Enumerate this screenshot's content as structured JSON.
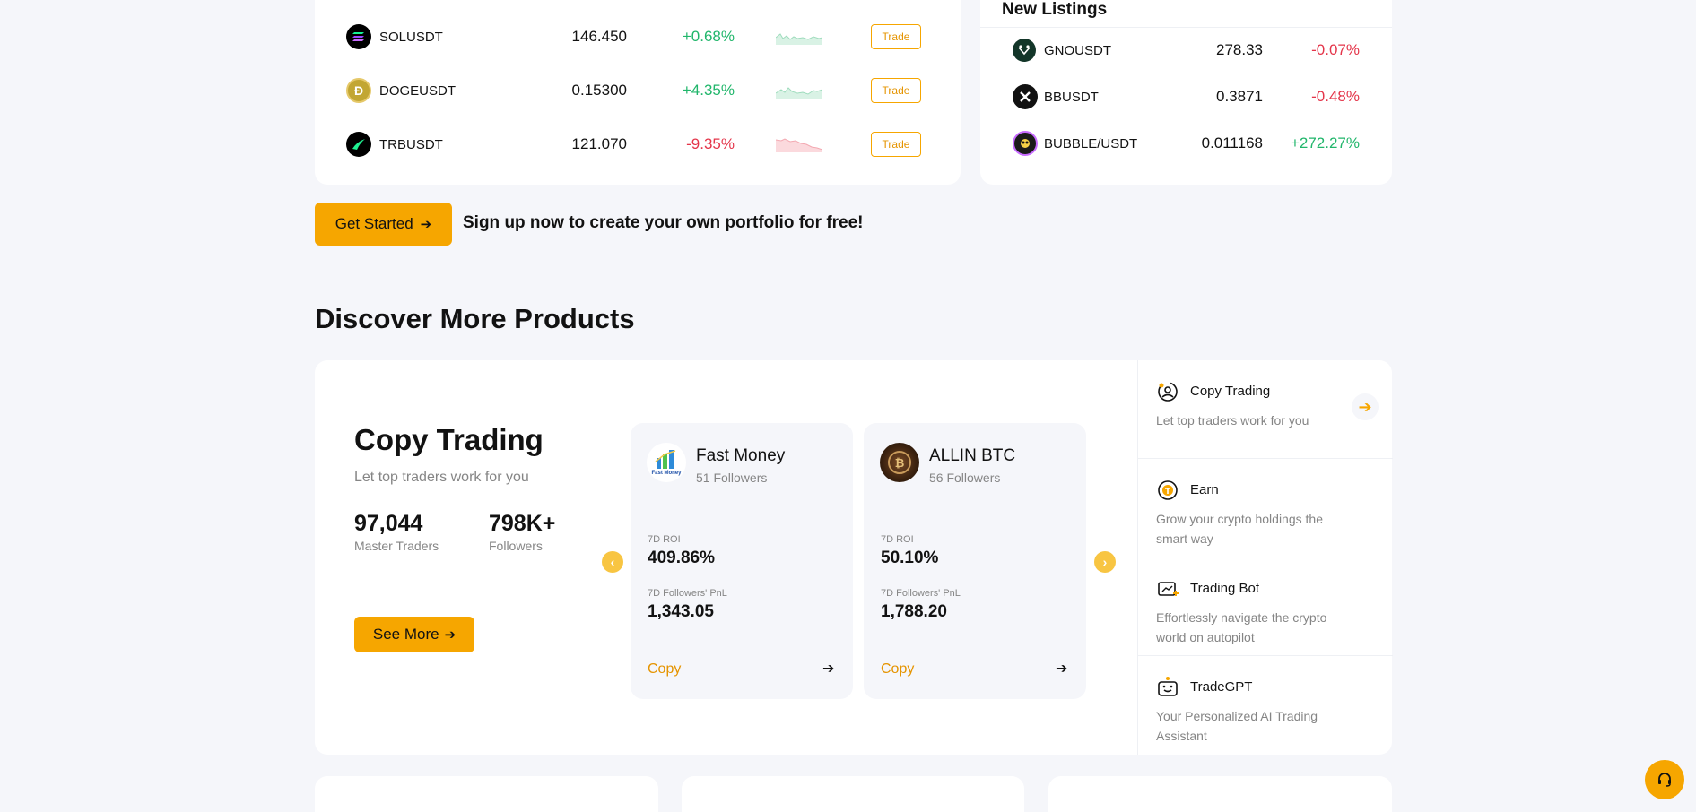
{
  "market": {
    "rows": [
      {
        "symbol": "SOLUSDT",
        "price": "146.450",
        "change": "+0.68%",
        "dir": "up",
        "icon": "solana-icon",
        "trade": "Trade"
      },
      {
        "symbol": "DOGEUSDT",
        "price": "0.15300",
        "change": "+4.35%",
        "dir": "up",
        "icon": "dogecoin-icon",
        "trade": "Trade"
      },
      {
        "symbol": "TRBUSDT",
        "price": "121.070",
        "change": "-9.35%",
        "dir": "down",
        "icon": "tellor-icon",
        "trade": "Trade"
      }
    ]
  },
  "new_listings": {
    "title": "New Listings",
    "rows": [
      {
        "symbol": "GNOUSDT",
        "price": "278.33",
        "change": "-0.07%",
        "dir": "down",
        "icon": "gnosis-icon"
      },
      {
        "symbol": "BBUSDT",
        "price": "0.3871",
        "change": "-0.48%",
        "dir": "down",
        "icon": "bouncebit-icon"
      },
      {
        "symbol": "BUBBLE/USDT",
        "price": "0.011168",
        "change": "+272.27%",
        "dir": "up",
        "icon": "bubble-icon"
      }
    ]
  },
  "cta": {
    "button": "Get Started",
    "text": "Sign up now to create your own portfolio for free!"
  },
  "discover": {
    "title": "Discover More Products",
    "copy_trading": {
      "title": "Copy Trading",
      "subtitle": "Let top traders work for you",
      "stats": [
        {
          "value": "97,044",
          "label": "Master Traders"
        },
        {
          "value": "798K+",
          "label": "Followers"
        }
      ],
      "see_more": "See More"
    },
    "traders": [
      {
        "name": "Fast Money",
        "followers": "51 Followers",
        "roi_label": "7D ROI",
        "roi": "409.86%",
        "pnl_label": "7D Followers' PnL",
        "pnl": "1,343.05",
        "copy": "Copy",
        "avatar_text": "Fast Money"
      },
      {
        "name": "ALLIN BTC",
        "followers": "56 Followers",
        "roi_label": "7D ROI",
        "roi": "50.10%",
        "pnl_label": "7D Followers' PnL",
        "pnl": "1,788.20",
        "copy": "Copy"
      }
    ],
    "side_items": [
      {
        "title": "Copy Trading",
        "desc": "Let top traders work for you"
      },
      {
        "title": "Earn",
        "desc": "Grow your crypto holdings the smart way"
      },
      {
        "title": "Trading Bot",
        "desc": "Effortlessly navigate the crypto world on autopilot"
      },
      {
        "title": "TradeGPT",
        "desc": "Your Personalized AI Trading Assistant"
      }
    ]
  },
  "colors": {
    "accent": "#f6a600",
    "up": "#21b66b",
    "down": "#e4354a"
  }
}
